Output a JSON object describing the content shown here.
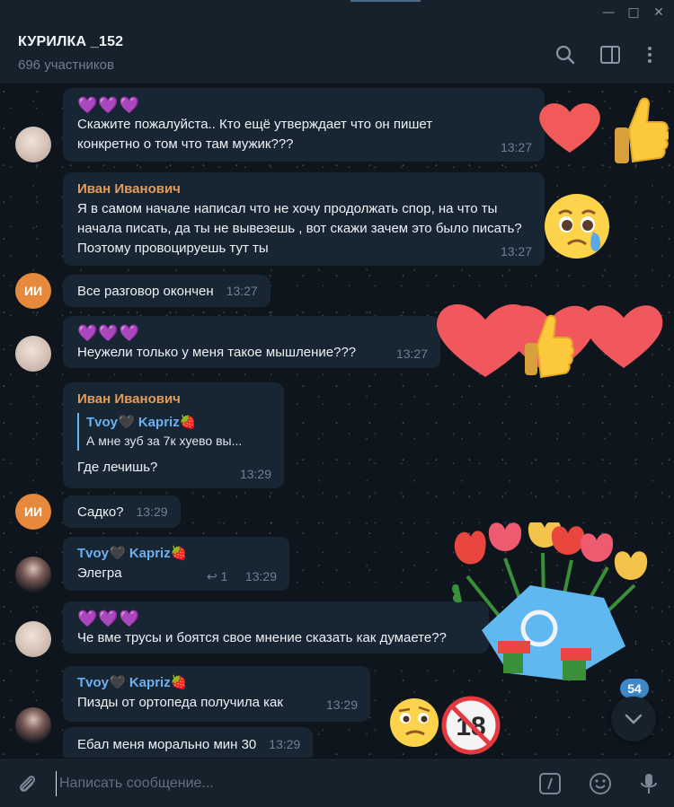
{
  "window": {
    "minimize": "—",
    "maximize": "□",
    "close": "✕"
  },
  "header": {
    "title": "КУРИЛКА _152",
    "subtitle": "696 участников",
    "icons": [
      "search-icon",
      "sidebar-toggle-icon",
      "more-vertical-icon"
    ]
  },
  "messages": [
    {
      "hearts": "💜💜💜",
      "text": "Скажите пожалуйста.. Кто ещё утверждает что он пишет конкретно о том что там мужик???",
      "time": "13:27"
    },
    {
      "sender": "Иван Иванович",
      "text": "Я в самом начале написал что не хочу продолжать спор, на что ты начала писать, да ты не вывезешь , вот скажи зачем это было писать? Поэтому провоцируешь тут ты",
      "time": "13:27"
    },
    {
      "text": "Все разговор окончен",
      "time": "13:27",
      "avatar": "ИИ"
    },
    {
      "hearts": "💜💜💜",
      "text": "Неужели только у меня такое мышление???",
      "time": "13:27"
    },
    {
      "sender": "Иван Иванович",
      "reply_name": "Tvoy🖤 Kapriz🍓",
      "reply_text": "А мне зуб за 7к хуево вы...",
      "text": "Где лечишь?",
      "time": "13:29"
    },
    {
      "text": "Садко?",
      "time": "13:29",
      "avatar": "ИИ"
    },
    {
      "sender": "Tvoy🖤 Kapriz🍓",
      "text": "Элегра",
      "reply_icon": "↩",
      "reply_count": "1",
      "time": "13:29"
    },
    {
      "hearts": "💜💜💜",
      "text": "Че вме трусы и боятся свое мнение сказать как думаете??"
    },
    {
      "sender": "Tvoy🖤 Kapriz🍓",
      "text": "Пизды от ортопеда получила как",
      "time": "13:29"
    },
    {
      "text": "Ебал меня морально мин 30",
      "time": "13:29"
    }
  ],
  "stickers": {
    "s1": "heart-thumbsup-sticker",
    "s2": "crying-face-sticker",
    "s3": "hearts-thumbsup-sticker",
    "s4": "tulip-bouquet-sticker",
    "s5": "confused-face-sticker",
    "s6": "no-18-sticker",
    "no18_text": "18"
  },
  "scroll": {
    "unread": "54"
  },
  "composer": {
    "placeholder": "Написать сообщение..."
  },
  "colors": {
    "bubble": "#182533",
    "accent_blue": "#6ab2f2",
    "sender_orange": "#e39c5a",
    "badge": "#3e88c7",
    "avatar_initials": "#e6893c"
  }
}
